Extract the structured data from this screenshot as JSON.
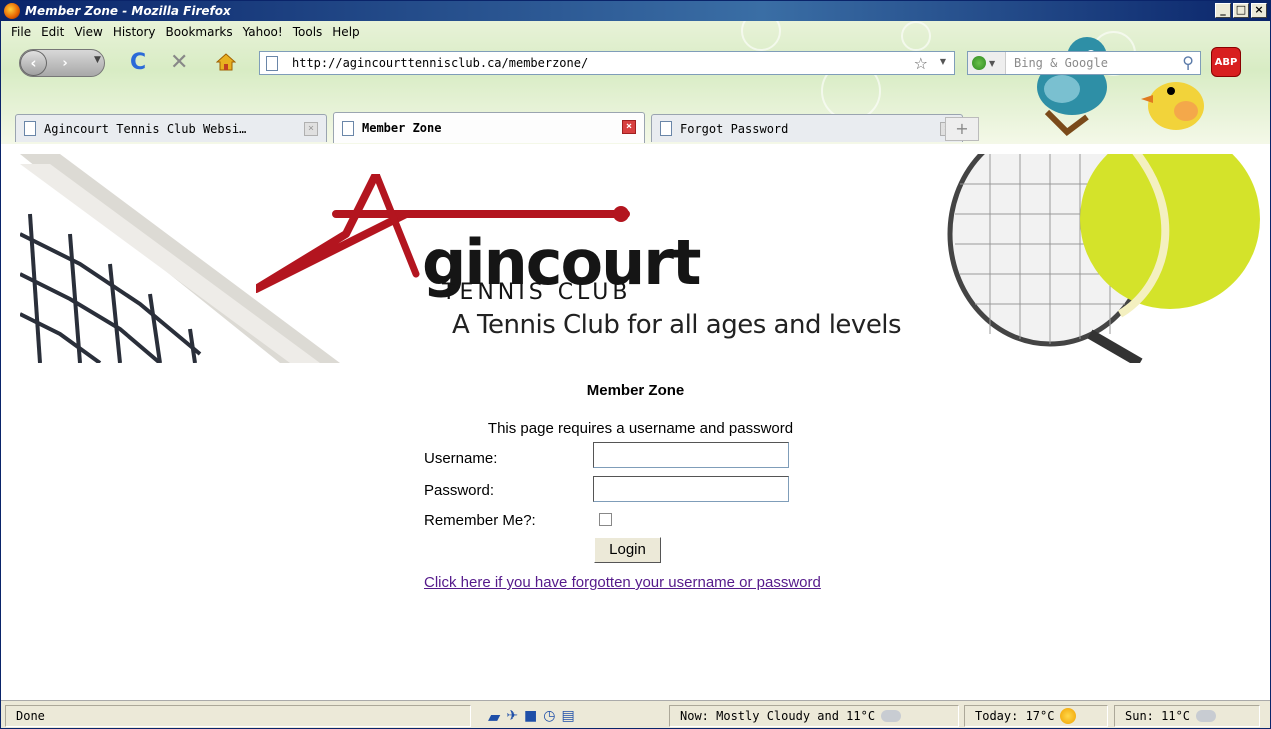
{
  "window": {
    "title": "Member Zone - Mozilla Firefox",
    "buttons": [
      "_",
      "□",
      "×"
    ]
  },
  "menu": [
    "File",
    "Edit",
    "View",
    "History",
    "Bookmarks",
    "Yahoo!",
    "Tools",
    "Help"
  ],
  "nav": {
    "url": "http://agincourttennisclub.ca/memberzone/",
    "search_placeholder": "Bing & Google",
    "abp_label": "ABP"
  },
  "tabs": [
    {
      "label": "Agincourt Tennis Club Websi…",
      "active": false
    },
    {
      "label": "Member Zone",
      "active": true
    },
    {
      "label": "Forgot Password",
      "active": false
    }
  ],
  "banner": {
    "logo_word": "gincourt",
    "logo_sub": "TENNIS CLUB",
    "tagline": "A Tennis Club for all ages and levels"
  },
  "form": {
    "title": "Member Zone",
    "note": "This page requires a username and password",
    "username_label": "Username:",
    "password_label": "Password:",
    "remember_label": "Remember Me?:",
    "login_label": "Login",
    "forgot_link": "Click here if you have forgotten your username or password"
  },
  "status": {
    "text": "Done",
    "now": "Now: Mostly Cloudy and 11°C",
    "today": "Today: 17°C",
    "sun": "Sun: 11°C"
  }
}
